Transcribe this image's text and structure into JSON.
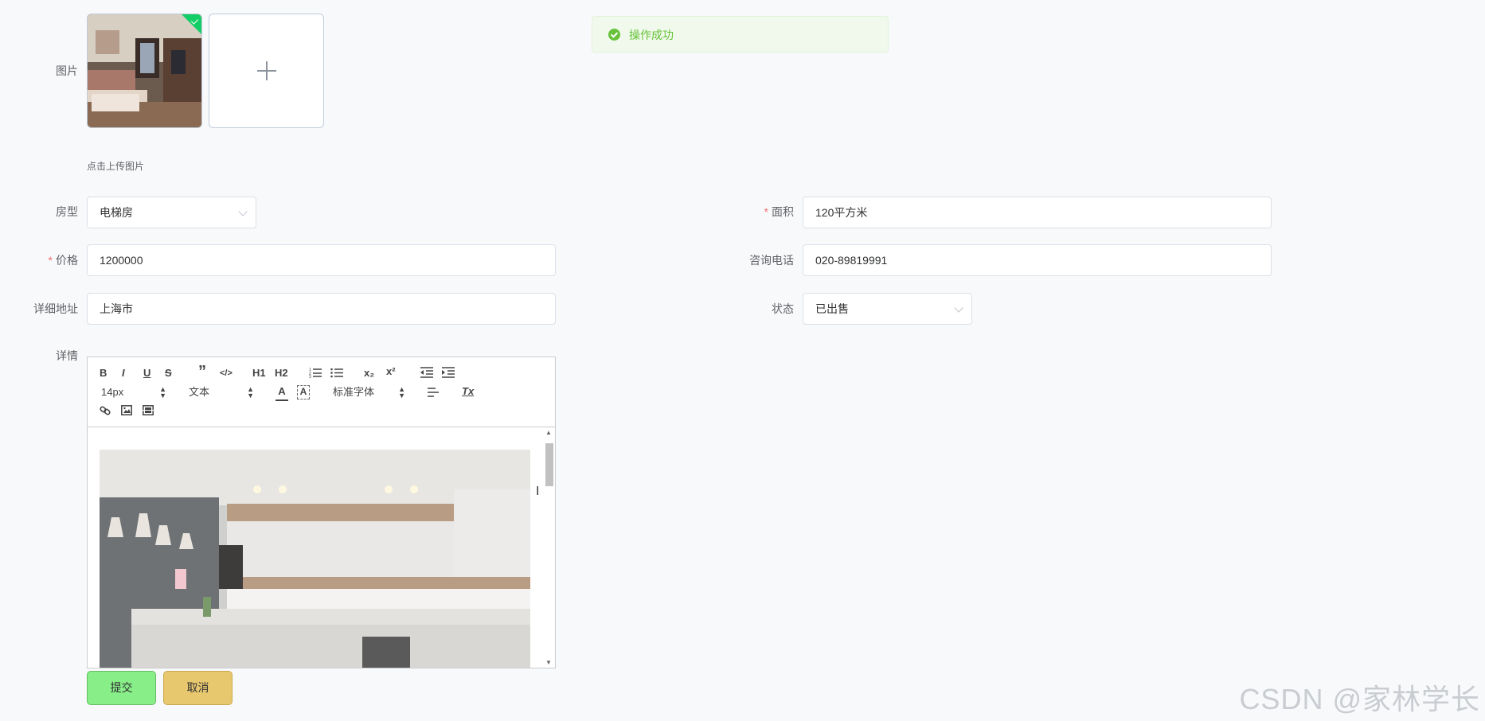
{
  "toast": {
    "message": "操作成功"
  },
  "form": {
    "image": {
      "label": "图片",
      "hint": "点击上传图片"
    },
    "room_type": {
      "label": "房型",
      "value": "电梯房"
    },
    "area": {
      "label": "面积",
      "value": "120平方米",
      "required": true
    },
    "price": {
      "label": "价格",
      "value": "1200000",
      "required": true
    },
    "phone": {
      "label": "咨询电话",
      "value": "020-89819991"
    },
    "address": {
      "label": "详细地址",
      "value": "上海市"
    },
    "status": {
      "label": "状态",
      "value": "已出售"
    },
    "details": {
      "label": "详情",
      "toolbar": {
        "bold": "B",
        "italic": "I",
        "underline": "U",
        "strike": "S",
        "blockquote": "”",
        "code": "</>",
        "h1": "H1",
        "h2": "H2",
        "subscript": "x₂",
        "superscript": "x²",
        "size": "14px",
        "header": "文本",
        "font": "标准字体",
        "clean": "Tx"
      }
    }
  },
  "buttons": {
    "submit": "提交",
    "cancel": "取消"
  },
  "watermark": "CSDN @家林学长",
  "colors": {
    "success": "#67c23a",
    "submit_bg": "#88ee88",
    "cancel_bg": "#e8c86e",
    "required": "#f56c6c"
  }
}
